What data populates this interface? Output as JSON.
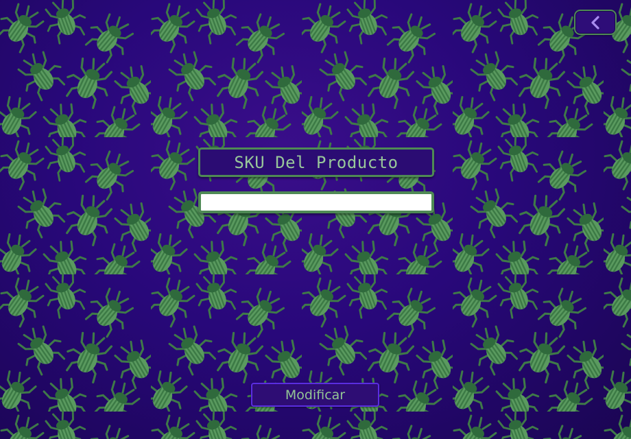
{
  "background": {
    "base_color": "#28087a",
    "pattern_icon": "beetle-icon",
    "pattern_color": "#4a8a52"
  },
  "header": {
    "back_icon": "chevron-left-icon"
  },
  "form": {
    "title": "SKU Del Producto",
    "sku_value": "",
    "sku_placeholder": ""
  },
  "actions": {
    "modify_label": "Modificar"
  },
  "colors": {
    "border_green": "#4f8a55",
    "text_green": "#98c79a",
    "button_border": "#5a2de0"
  }
}
